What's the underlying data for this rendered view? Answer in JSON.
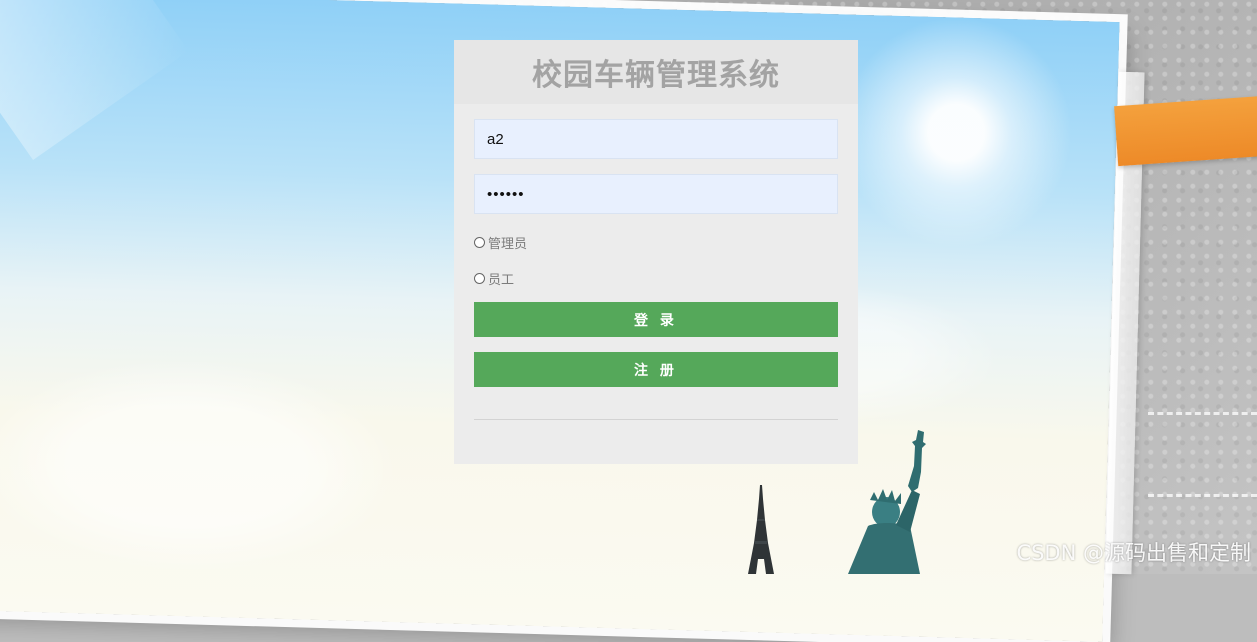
{
  "app": {
    "title": "校园车辆管理系统"
  },
  "login_form": {
    "username_value": "a2",
    "password_value": "••••••",
    "roles": [
      {
        "label": "管理员",
        "selected": false
      },
      {
        "label": "员工",
        "selected": false
      }
    ],
    "login_button": "登 录",
    "register_button": "注 册"
  },
  "watermark": {
    "text": "CSDN @源码出售和定制"
  },
  "icons": {
    "landmarks": [
      "eiffel-tower-icon",
      "statue-of-liberty-icon"
    ]
  },
  "colors": {
    "panel_bg": "#ececec",
    "title_color": "#a3a3a3",
    "input_bg": "#e8f0fe",
    "button_green": "#55a85a",
    "ribbon_orange": "#ef8d2b",
    "sky_top": "#8fd0f7"
  }
}
